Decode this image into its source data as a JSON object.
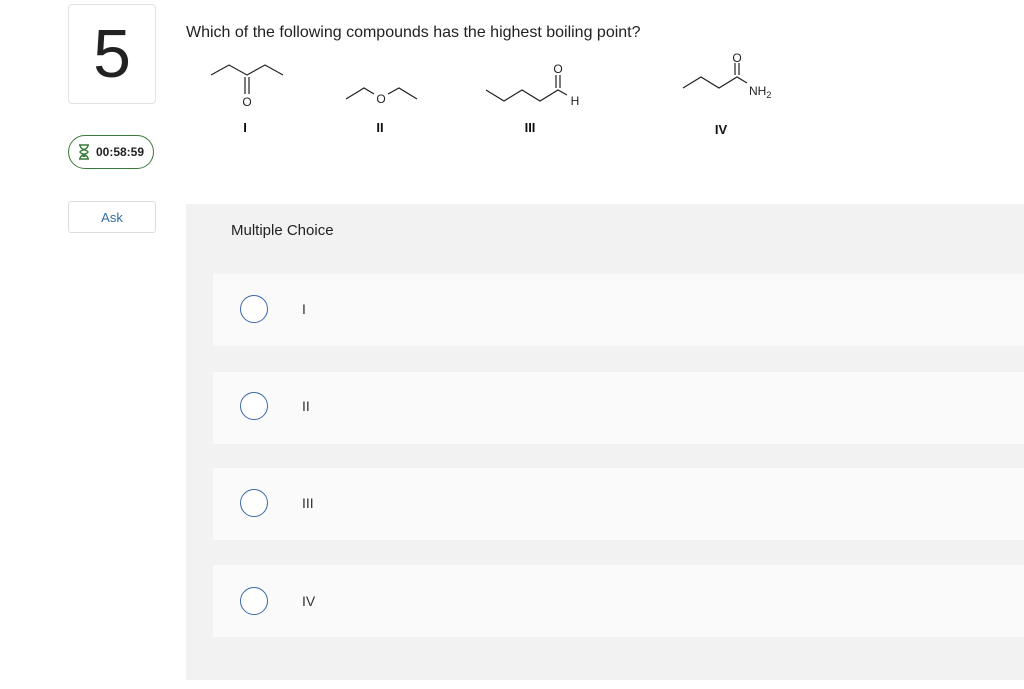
{
  "question": {
    "number": "5",
    "text": "Which of the following compounds has the highest boiling point?"
  },
  "sidebar": {
    "timer": "00:58:59",
    "ask_label": "Ask"
  },
  "structures": {
    "labels": [
      "I",
      "II",
      "III",
      "IV"
    ],
    "atoms": {
      "ketone_O": "O",
      "ether_O": "O",
      "aldehyde_O": "O",
      "aldehyde_H": "H",
      "amide_O": "O",
      "amide_N": "NH",
      "amide_N_sub": "2"
    }
  },
  "multiple_choice": {
    "title": "Multiple Choice",
    "options": [
      {
        "label": "I"
      },
      {
        "label": "II"
      },
      {
        "label": "III"
      },
      {
        "label": "IV"
      }
    ]
  },
  "colors": {
    "timer_border": "#3a7a3a",
    "radio_border": "#3a68a8",
    "ask_text": "#2e6ea6",
    "panel_bg": "#f2f2f2"
  }
}
